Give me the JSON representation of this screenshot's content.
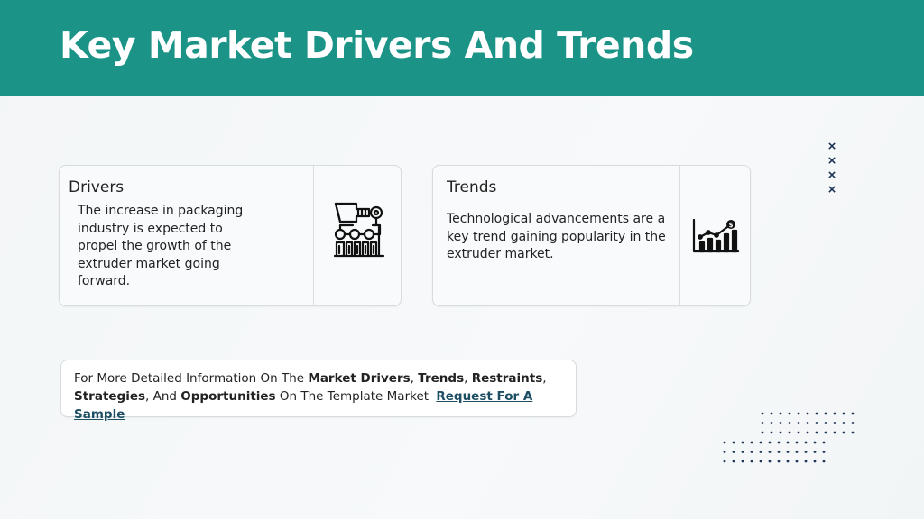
{
  "header": {
    "title": "Key Market Drivers And Trends"
  },
  "drivers": {
    "title": "Drivers",
    "text": "The increase in packaging industry is expected to propel the growth of the extruder market going forward.",
    "icon": "industrial-machine-icon"
  },
  "trends": {
    "title": "Trends",
    "text": "Technological advancements are a key trend gaining popularity in the extruder market.",
    "icon": "growth-chart-icon"
  },
  "info": {
    "prefix": "For More Detailed Information On The ",
    "market_drivers": "Market Drivers",
    "sep1": ", ",
    "trends": "Trends",
    "sep2": ", ",
    "restraints": "Restraints",
    "sep3": ",",
    "strategies": "Strategies",
    "sep4": ", And ",
    "opportunities": "Opportunities",
    "suffix": " On The Template Market ",
    "link": "Request For A Sample"
  },
  "decor": {
    "xmark": "×",
    "header_color": "#1b9387",
    "accent_navy": "#1d3557"
  }
}
